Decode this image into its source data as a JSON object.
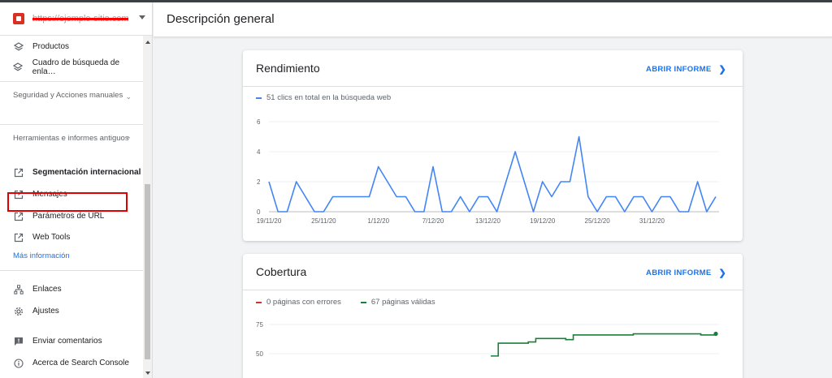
{
  "sidebar": {
    "property_url": "https://ejemplo-sitio.com/",
    "items_top": [
      {
        "label": "Productos",
        "icon": "layers-icon"
      },
      {
        "label": "Cuadro de búsqueda de enla…",
        "icon": "layers-icon"
      }
    ],
    "section_security": "Seguridad y Acciones manuales",
    "section_legacy": "Herramientas e informes antiguos",
    "legacy_items": [
      {
        "label": "Segmentación internacional",
        "icon": "external-link-icon"
      },
      {
        "label": "Mensajes",
        "icon": "external-link-icon"
      },
      {
        "label": "Parámetros de URL",
        "icon": "external-link-icon"
      },
      {
        "label": "Web Tools",
        "icon": "external-link-icon"
      }
    ],
    "more_info": "Más información",
    "items_bottom": [
      {
        "label": "Enlaces",
        "icon": "links-icon"
      },
      {
        "label": "Ajustes",
        "icon": "gear-icon"
      },
      {
        "label": "Enviar comentarios",
        "icon": "feedback-icon"
      },
      {
        "label": "Acerca de Search Console",
        "icon": "info-icon"
      }
    ]
  },
  "header": {
    "title": "Descripción general"
  },
  "performance": {
    "title": "Rendimiento",
    "open_report": "ABRIR INFORME",
    "legend": "51 clics en total en la búsqueda web",
    "color": "#4285f4"
  },
  "coverage": {
    "title": "Cobertura",
    "open_report": "ABRIR INFORME",
    "legend_errors": "0 páginas con errores",
    "legend_valid": "67 páginas válidas",
    "error_color": "#d93025",
    "valid_color": "#188038"
  },
  "chart_data": [
    {
      "type": "line",
      "series": [
        {
          "name": "51 clics en total en la búsqueda web",
          "values": [
            2,
            0,
            0,
            2,
            1,
            0,
            0,
            1,
            1,
            1,
            1,
            1,
            3,
            2,
            1,
            1,
            0,
            0,
            3,
            0,
            0,
            1,
            0,
            1,
            1,
            0,
            2,
            4,
            2,
            0,
            2,
            1,
            2,
            2,
            5,
            1,
            0,
            1,
            1,
            0,
            1,
            1,
            0,
            1,
            1,
            0,
            0,
            2,
            0,
            1
          ]
        }
      ],
      "x_ticks": [
        "19/11/20",
        "25/11/20",
        "1/12/20",
        "7/12/20",
        "13/12/20",
        "19/12/20",
        "25/12/20",
        "31/12/20"
      ],
      "y_ticks": [
        0,
        2,
        4,
        6
      ],
      "ylim": [
        0,
        6
      ]
    },
    {
      "type": "line",
      "series": [
        {
          "name": "67 páginas válidas",
          "values": [
            48,
            59,
            59,
            59,
            59,
            60,
            63,
            63,
            63,
            63,
            62,
            66,
            66,
            66,
            66,
            66,
            66,
            66,
            66,
            67,
            67,
            67,
            67,
            67,
            67,
            67,
            67,
            67,
            66,
            66,
            67
          ]
        }
      ],
      "y_ticks": [
        50,
        75
      ]
    }
  ]
}
